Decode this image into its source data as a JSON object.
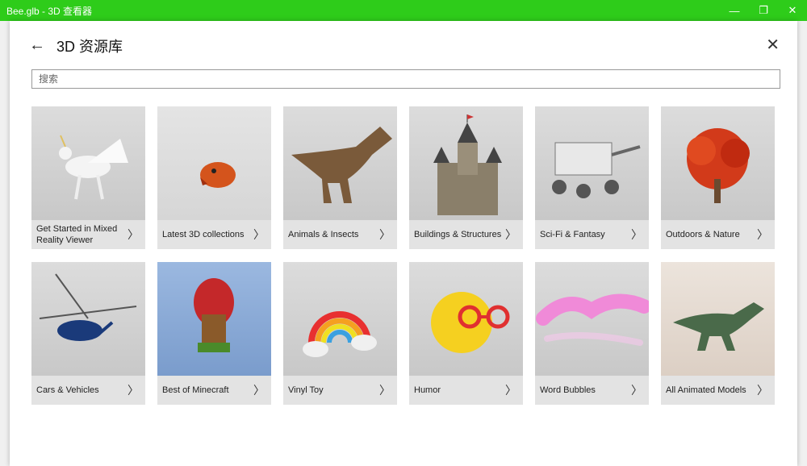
{
  "window": {
    "title": "Bee.glb - 3D 查看器",
    "minimize": "—",
    "restore": "❐",
    "close": "✕"
  },
  "dialog": {
    "title": "3D 资源库",
    "back_icon": "←",
    "close_icon": "✕"
  },
  "search": {
    "placeholder": "搜索"
  },
  "tiles": [
    {
      "label": "Get Started in Mixed Reality Viewer"
    },
    {
      "label": "Latest 3D collections"
    },
    {
      "label": "Animals & Insects"
    },
    {
      "label": "Buildings & Structures"
    },
    {
      "label": "Sci-Fi & Fantasy"
    },
    {
      "label": "Outdoors & Nature"
    },
    {
      "label": "Cars & Vehicles"
    },
    {
      "label": "Best of Minecraft"
    },
    {
      "label": "Vinyl Toy"
    },
    {
      "label": "Humor"
    },
    {
      "label": "Word Bubbles"
    },
    {
      "label": "All Animated Models"
    }
  ],
  "chevron": "〉",
  "colors": {
    "titlebar": "#2ecc1a"
  }
}
